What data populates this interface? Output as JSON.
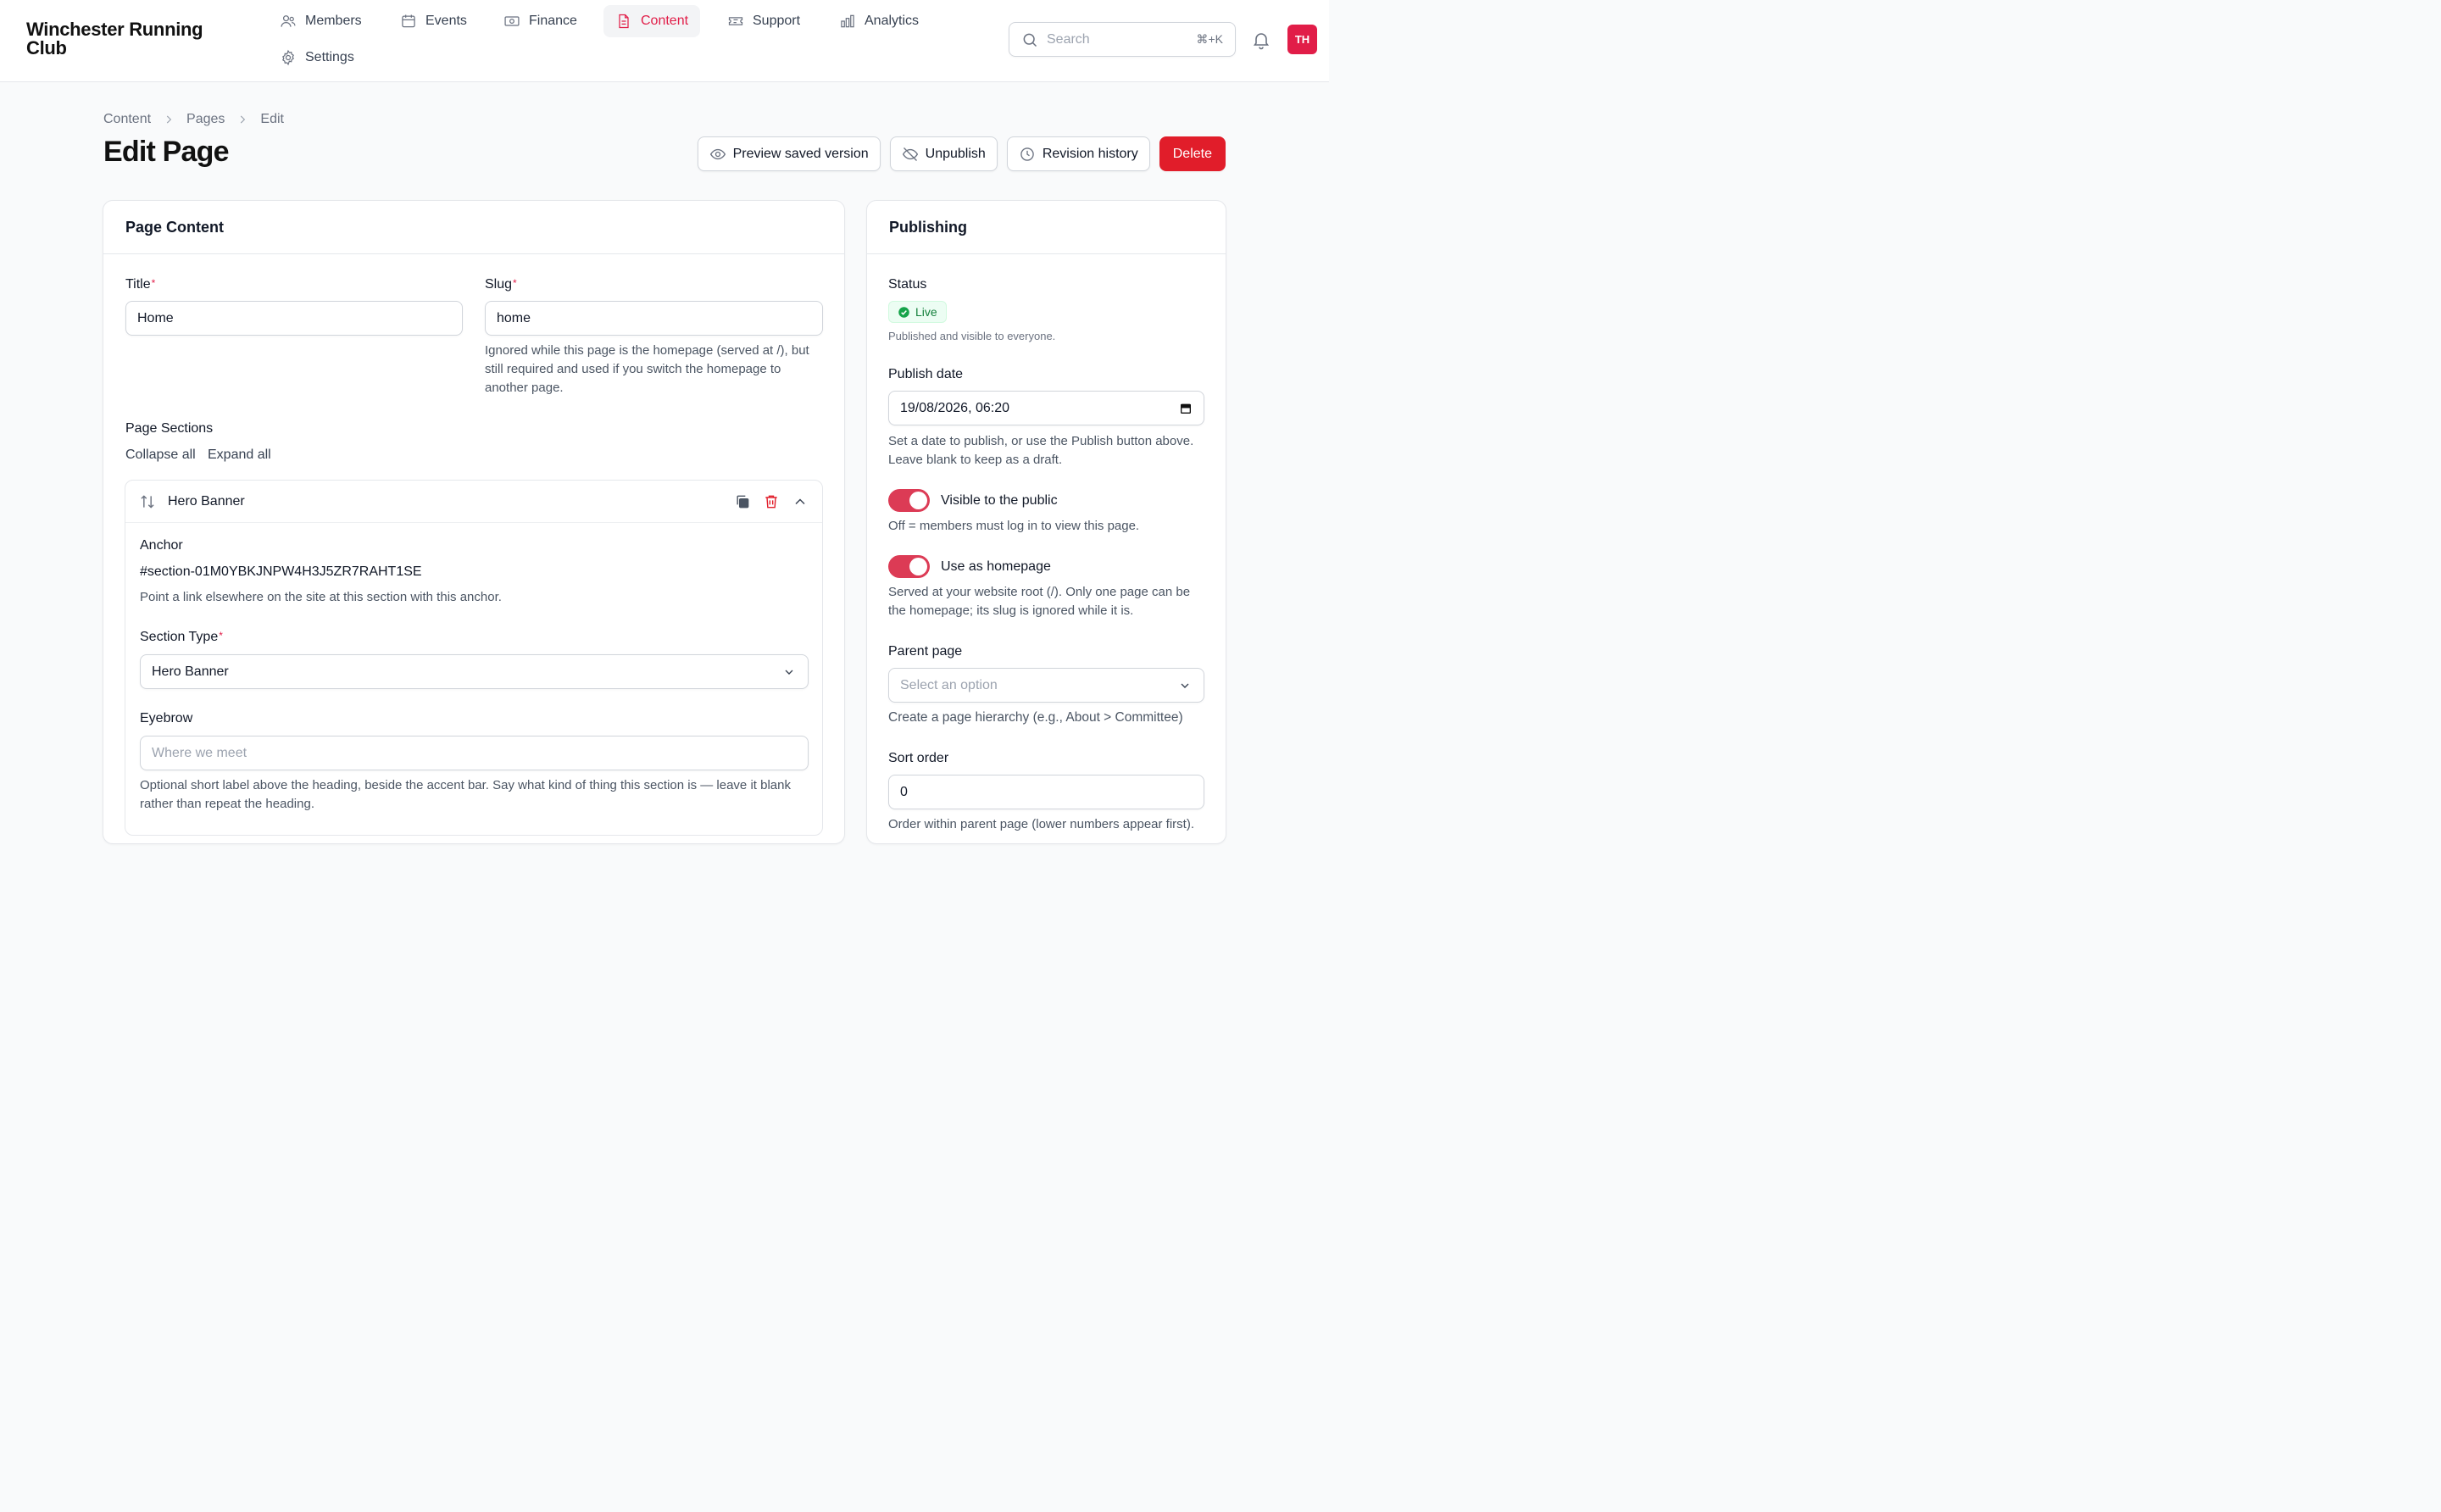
{
  "app": {
    "brand": "Winchester Running Club"
  },
  "nav": {
    "items": [
      {
        "label": "Members",
        "icon": "users-icon"
      },
      {
        "label": "Events",
        "icon": "calendar-icon"
      },
      {
        "label": "Finance",
        "icon": "banknote-icon"
      },
      {
        "label": "Content",
        "icon": "document-icon",
        "active": true
      },
      {
        "label": "Support",
        "icon": "ticket-icon"
      },
      {
        "label": "Analytics",
        "icon": "bar-chart-icon"
      },
      {
        "label": "Settings",
        "icon": "gear-icon"
      }
    ]
  },
  "search": {
    "placeholder": "Search",
    "shortcut": "⌘+K"
  },
  "user": {
    "initials": "TH"
  },
  "breadcrumb": [
    "Content",
    "Pages",
    "Edit"
  ],
  "page": {
    "title": "Edit Page"
  },
  "actions": {
    "preview": "Preview saved version",
    "unpublish": "Unpublish",
    "history": "Revision history",
    "delete": "Delete"
  },
  "content_card": {
    "heading": "Page Content",
    "title_label": "Title",
    "title_value": "Home",
    "slug_label": "Slug",
    "slug_value": "home",
    "slug_help": "Ignored while this page is the homepage (served at /), but still required and used if you switch the homepage to another page.",
    "sections_label": "Page Sections",
    "collapse_all": "Collapse all",
    "expand_all": "Expand all",
    "section": {
      "name": "Hero Banner",
      "anchor_label": "Anchor",
      "anchor_value": "#section-01M0YBKJNPW4H3J5ZR7RAHT1SE",
      "anchor_help": "Point a link elsewhere on the site at this section with this anchor.",
      "type_label": "Section Type",
      "type_value": "Hero Banner",
      "eyebrow_label": "Eyebrow",
      "eyebrow_placeholder": "Where we meet",
      "eyebrow_help": "Optional short label above the heading, beside the accent bar. Say what kind of thing this section is — leave it blank rather than repeat the heading."
    }
  },
  "publishing": {
    "heading": "Publishing",
    "status_label": "Status",
    "status_value": "Live",
    "status_help": "Published and visible to everyone.",
    "date_label": "Publish date",
    "date_value": "19/08/2026, 06:20",
    "date_help": "Set a date to publish, or use the Publish button above. Leave blank to keep as a draft.",
    "visible_label": "Visible to the public",
    "visible_help": "Off = members must log in to view this page.",
    "homepage_label": "Use as homepage",
    "homepage_help": "Served at your website root (/). Only one page can be the homepage; its slug is ignored while it is.",
    "parent_label": "Parent page",
    "parent_placeholder": "Select an option",
    "parent_help": "Create a page hierarchy (e.g., About > Committee)",
    "sort_label": "Sort order",
    "sort_value": "0",
    "sort_help": "Order within parent page (lower numbers appear first)."
  },
  "colors": {
    "accent": "#e11d48",
    "danger": "#e11d2a",
    "success": "#15803d"
  }
}
